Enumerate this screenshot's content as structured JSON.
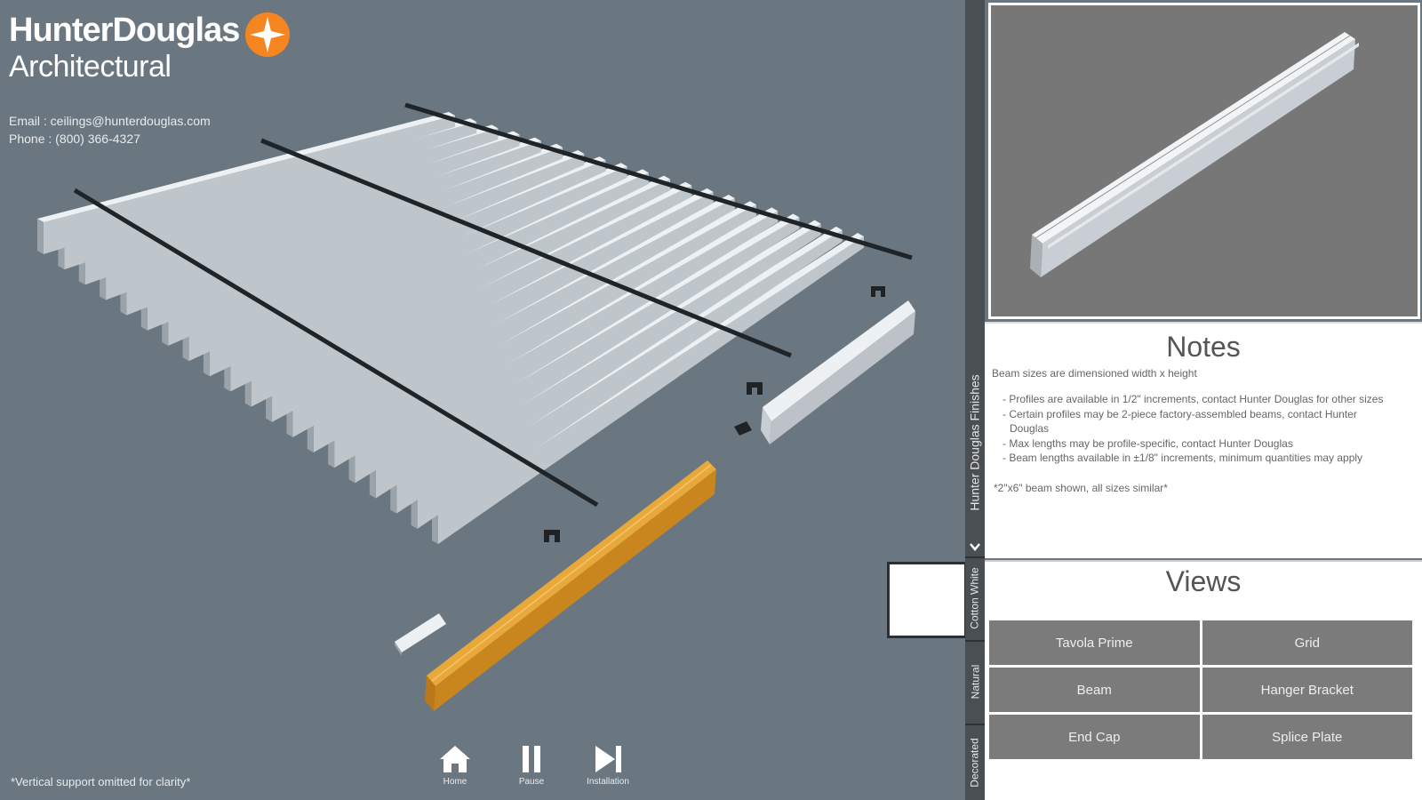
{
  "brand": {
    "name": "HunterDouglas",
    "sub": "Architectural",
    "email": "Email : ceilings@hunterdouglas.com",
    "phone": "Phone : (800) 366-4327"
  },
  "footnote": "*Vertical support omitted for clarity*",
  "controls": [
    {
      "label": "Home",
      "icon": "home-icon"
    },
    {
      "label": "Pause",
      "icon": "pause-icon"
    },
    {
      "label": "Installation",
      "icon": "skip-next-icon"
    }
  ],
  "finishes": {
    "title": "Hunter Douglas Finishes",
    "tabs": [
      "Cotton White",
      "Natural",
      "Decorated"
    ]
  },
  "notes": {
    "title": "Notes",
    "subtitle": "Beam sizes are dimensioned width x height",
    "items": [
      "- Profiles are available in 1/2\" increments, contact Hunter Douglas for other sizes",
      "- Certain profiles may be 2-piece factory-assembled beams, contact Hunter Douglas",
      "- Max lengths may be profile-specific, contact Hunter Douglas",
      "- Beam lengths available in ±1/8\" increments, minimum quantities may apply"
    ],
    "footer": "*2\"x6\" beam shown, all sizes similar*"
  },
  "views": {
    "title": "Views",
    "buttons": [
      "Tavola Prime",
      "Grid",
      "Beam",
      "Hanger Bracket",
      "End Cap",
      "Splice Plate"
    ]
  },
  "colors": {
    "viewport_bg": "#6a7780",
    "accent_orange": "#f5851f",
    "highlight_beam": "#d4901c",
    "panel_button": "#7b7b7b"
  }
}
